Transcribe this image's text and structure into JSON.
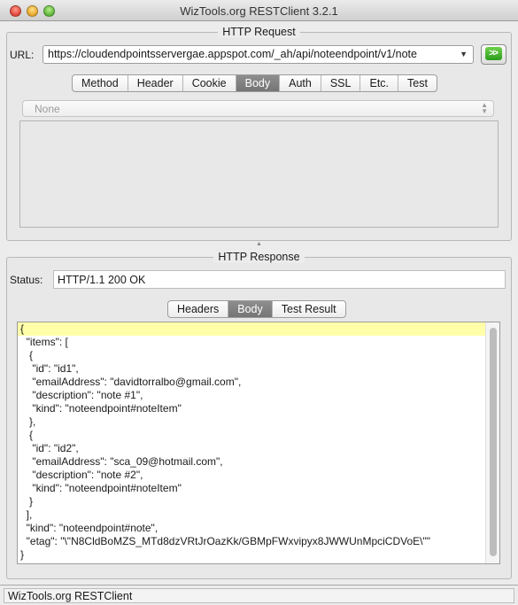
{
  "window": {
    "title": "WizTools.org RESTClient 3.2.1"
  },
  "request": {
    "section_title": "HTTP Request",
    "url_label": "URL:",
    "url_value": "https://cloudendpointsservergae.appspot.com/_ah/api/noteendpoint/v1/note",
    "go_button_glyph": ">>",
    "tabs": [
      {
        "label": "Method"
      },
      {
        "label": "Header"
      },
      {
        "label": "Cookie"
      },
      {
        "label": "Body",
        "active": true
      },
      {
        "label": "Auth"
      },
      {
        "label": "SSL"
      },
      {
        "label": "Etc."
      },
      {
        "label": "Test"
      }
    ],
    "body_content_type": "None"
  },
  "response": {
    "section_title": "HTTP Response",
    "status_label": "Status:",
    "status_value": "HTTP/1.1 200 OK",
    "tabs": [
      {
        "label": "Headers"
      },
      {
        "label": "Body",
        "active": true
      },
      {
        "label": "Test Result"
      }
    ],
    "body_lines": [
      "{",
      "  \"items\": [",
      "   {",
      "    \"id\": \"id1\",",
      "    \"emailAddress\": \"davidtorralbo@gmail.com\",",
      "    \"description\": \"note #1\",",
      "    \"kind\": \"noteendpoint#noteItem\"",
      "   },",
      "   {",
      "    \"id\": \"id2\",",
      "    \"emailAddress\": \"sca_09@hotmail.com\",",
      "    \"description\": \"note #2\",",
      "    \"kind\": \"noteendpoint#noteItem\"",
      "   }",
      "  ],",
      "  \"kind\": \"noteendpoint#note\",",
      "  \"etag\": \"\\\"N8CldBoMZS_MTd8dzVRtJrOazKk/GBMpFWxvipyx8JWWUnMpciCDVoE\\\"\"",
      "}"
    ]
  },
  "statusbar": {
    "text": "WizTools.org RESTClient"
  }
}
